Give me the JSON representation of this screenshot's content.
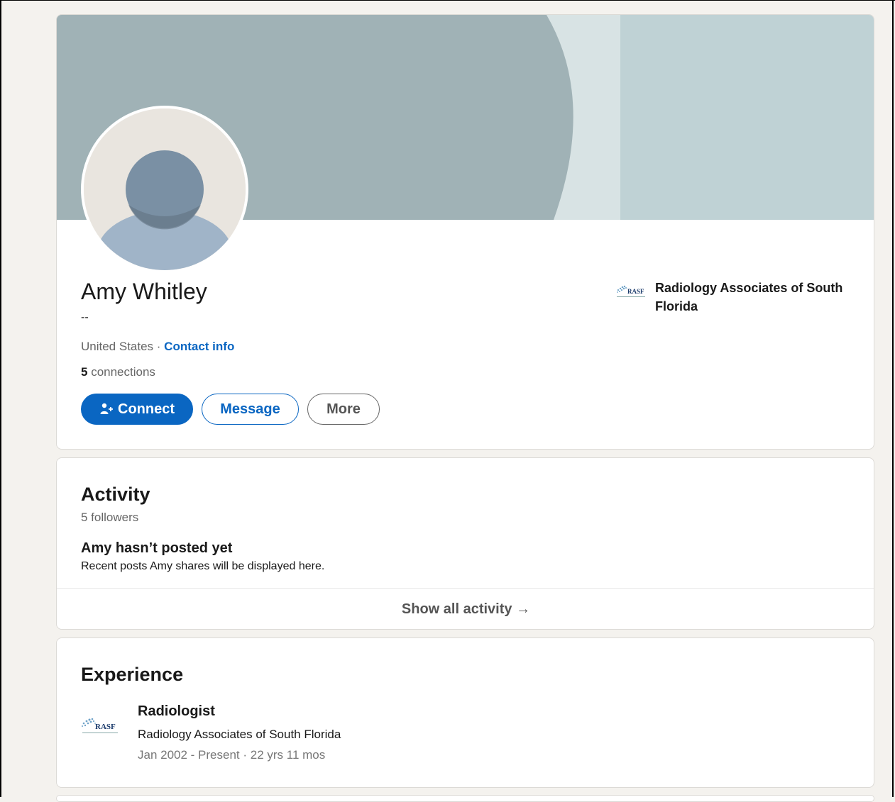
{
  "profile": {
    "name": "Amy Whitley",
    "headline": "--",
    "location": "United States",
    "separator": " · ",
    "contact_label": "Contact info",
    "connections_count": "5",
    "connections_label": " connections",
    "company": "Radiology Associates of South Florida",
    "company_logo_text": "RASF",
    "actions": {
      "connect": "Connect",
      "message": "Message",
      "more": "More"
    }
  },
  "activity": {
    "title": "Activity",
    "followers": "5 followers",
    "empty_heading": "Amy hasn’t posted yet",
    "empty_text": "Recent posts Amy shares will be displayed here.",
    "show_all": "Show all activity →"
  },
  "experience": {
    "title": "Experience",
    "items": [
      {
        "role": "Radiologist",
        "company": "Radiology Associates of South Florida",
        "dates": "Jan 2002 - Present · 22 yrs 11 mos",
        "logo_text": "RASF"
      }
    ]
  },
  "colors": {
    "brand": "#0a66c2",
    "banner_main": "#a0b2b6",
    "banner_light": "#bfd2d5",
    "avatar_bg": "#e9e5df",
    "avatar_figure": "#7a90a4"
  }
}
